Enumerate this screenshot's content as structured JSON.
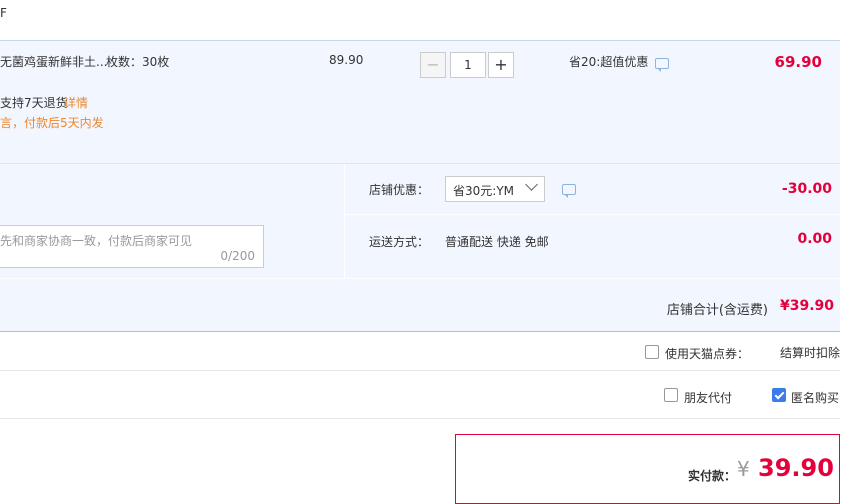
{
  "colors": {
    "accent": "#e4003a",
    "orange": "#f0862a",
    "link": "#f0862a",
    "row_bg": "#f2f7ff",
    "check": "#3b7bea"
  },
  "top": {
    "fragment": "F"
  },
  "item": {
    "title": "无菌鸡蛋新鲜非土...",
    "sku": "枚数：30枚",
    "unit_price": "89.90",
    "quantity": "1",
    "discount": "省20:超值优惠",
    "subtotal": "69.90",
    "service": "支持7天退货",
    "service_link": "详情",
    "shipping_note": "言，付款后5天内发"
  },
  "shop": {
    "coupon_label": "店铺优惠：",
    "coupon_value": "省30元:YM",
    "coupon_amount": "-30.00",
    "memo_placeholder": "先和商家协商一致，付款后商家可见",
    "memo_count": "0/200",
    "delivery_label": "运送方式：",
    "delivery_value": "普通配送 快递 免邮",
    "delivery_amount": "0.00",
    "total_label": "店铺合计(含运费)",
    "total_value": "¥39.90"
  },
  "points": {
    "label": "使用天猫点券：",
    "note": "结算时扣除"
  },
  "options": {
    "friend_pay": "朋友代付",
    "anonymous": "匿名购买"
  },
  "payment": {
    "label": "实付款：",
    "currency": "¥",
    "amount": "39.90"
  }
}
